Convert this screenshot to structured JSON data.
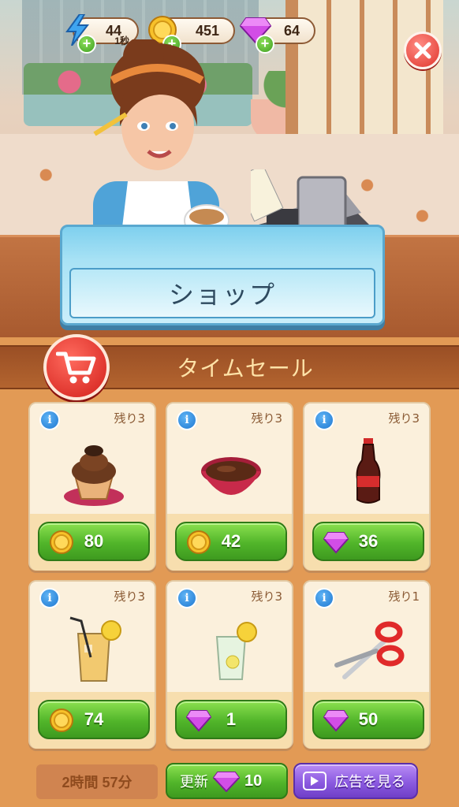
{
  "resources": {
    "energy": {
      "value": "44",
      "timer": "1秒",
      "icon": "lightning-icon"
    },
    "coins": {
      "value": "451",
      "icon": "coin-icon"
    },
    "gems": {
      "value": "64",
      "icon": "gem-icon"
    }
  },
  "banner": {
    "title": "ショップ"
  },
  "section": {
    "title": "タイムセール"
  },
  "items": [
    {
      "name": "chocolate-cupcake",
      "remain": "残り3",
      "price": "80",
      "currency": "coin"
    },
    {
      "name": "chocolate-bowl",
      "remain": "残り3",
      "price": "42",
      "currency": "coin"
    },
    {
      "name": "cola-bottle",
      "remain": "残り3",
      "price": "36",
      "currency": "gem"
    },
    {
      "name": "iced-tea-glass",
      "remain": "残り3",
      "price": "74",
      "currency": "coin"
    },
    {
      "name": "lemon-water-glass",
      "remain": "残り3",
      "price": "1",
      "currency": "gem"
    },
    {
      "name": "scissors",
      "remain": "残り1",
      "price": "50",
      "currency": "gem"
    }
  ],
  "bottom": {
    "timer": "2時間 57分",
    "refresh_label": "更新",
    "refresh_cost": "10",
    "ad_label": "広告を見る"
  },
  "colors": {
    "green_button": "#51b52a",
    "purple_button": "#8b5ae0",
    "close_red": "#e0342b",
    "card_bg": "#fff6e6",
    "wood": "#e29a55"
  }
}
